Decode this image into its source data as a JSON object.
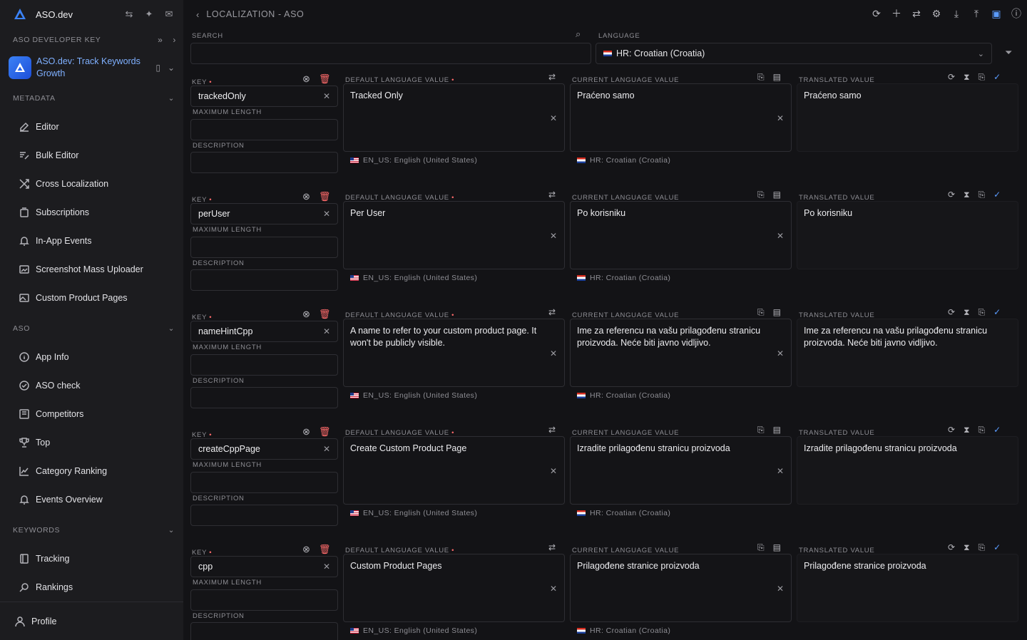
{
  "sidebar": {
    "brand": "ASO.dev",
    "dev_key_label": "ASO DEVELOPER KEY",
    "app_name": "ASO.dev: Track Keywords Growth",
    "sections": {
      "metadata": "METADATA",
      "aso": "ASO",
      "keywords": "KEYWORDS"
    },
    "metadata_items": [
      "Editor",
      "Bulk Editor",
      "Cross Localization",
      "Subscriptions",
      "In-App Events",
      "Screenshot Mass Uploader",
      "Custom Product Pages"
    ],
    "aso_items": [
      "App Info",
      "ASO check",
      "Competitors",
      "Top",
      "Category Ranking",
      "Events Overview"
    ],
    "keyword_items": [
      "Tracking",
      "Rankings"
    ],
    "profile": "Profile"
  },
  "header": {
    "title": "LOCALIZATION - ASO",
    "search_label": "SEARCH",
    "search_value": "",
    "language_label": "LANGUAGE",
    "language_value": "HR: Croatian (Croatia)"
  },
  "labels": {
    "key": "KEY",
    "max_length": "MAXIMUM LENGTH",
    "description": "DESCRIPTION",
    "default_value": "DEFAULT LANGUAGE VALUE",
    "current_value": "CURRENT LANGUAGE VALUE",
    "translated_value": "TRANSLATED VALUE",
    "required_mark": "•",
    "default_lang_note": "EN_US: English (United States)",
    "current_lang_note": "HR: Croatian (Croatia)"
  },
  "rows": [
    {
      "key": "trackedOnly",
      "default_value": "Tracked Only",
      "current_value": "Praćeno samo",
      "translated_value": "Praćeno samo"
    },
    {
      "key": "perUser",
      "default_value": "Per User",
      "current_value": "Po korisniku",
      "translated_value": "Po korisniku"
    },
    {
      "key": "nameHintCpp",
      "default_value": "A name to refer to your custom product page. It won't be publicly visible.",
      "current_value": "Ime za referencu na vašu prilagođenu stranicu proizvoda. Neće biti javno vidljivo.",
      "translated_value": "Ime za referencu na vašu prilagođenu stranicu proizvoda. Neće biti javno vidljivo."
    },
    {
      "key": "createCppPage",
      "default_value": "Create Custom Product Page",
      "current_value": "Izradite prilagođenu stranicu proizvoda",
      "translated_value": "Izradite prilagođenu stranicu proizvoda"
    },
    {
      "key": "cpp",
      "default_value": "Custom Product Pages",
      "current_value": "Prilagođene stranice proizvoda",
      "translated_value": "Prilagođene stranice proizvoda"
    }
  ]
}
